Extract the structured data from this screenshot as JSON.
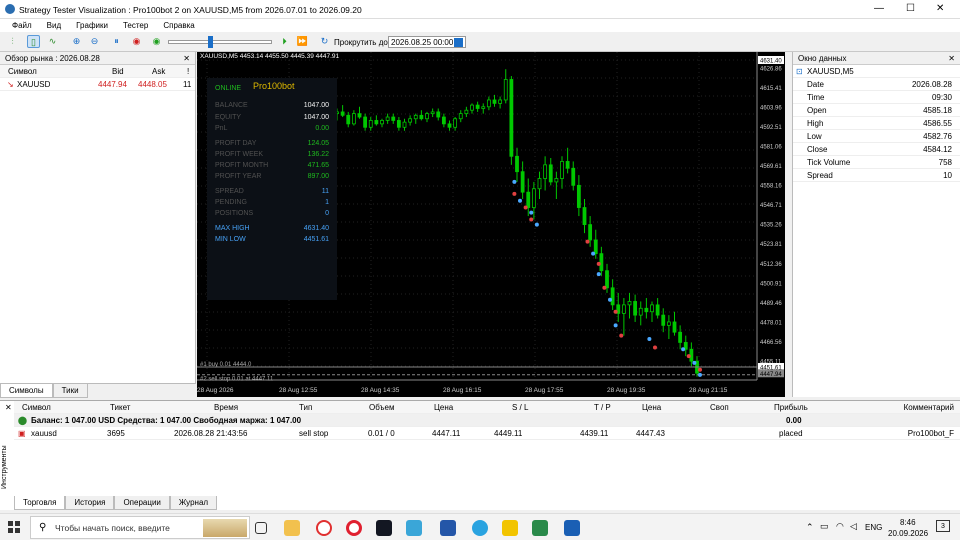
{
  "window": {
    "title": "Strategy Tester Visualization : Pro100bot 2 on XAUUSD,M5 from 2026.07.01 to 2026.09.20",
    "min": "—",
    "max": "☐",
    "close": "✕"
  },
  "menu": [
    "Файл",
    "Вид",
    "Графики",
    "Тестер",
    "Справка"
  ],
  "toolbar": {
    "scroll_label": "Прокрутить до",
    "date_value": "2026.08.25 00:00"
  },
  "market_watch": {
    "title": "Обзор рынка : 2026.08.28",
    "col_symbol": "Символ",
    "col_bid": "Bid",
    "col_ask": "Ask",
    "col_n": "!",
    "symbol": "XAUUSD",
    "bid": "4447.94",
    "ask": "4448.05",
    "n": "11",
    "tabs": [
      "Символы",
      "Тики"
    ]
  },
  "data_window": {
    "title": "Окно данных",
    "symbol": "XAUUSD,M5",
    "rows": [
      [
        "Date",
        "2026.08.28"
      ],
      [
        "Time",
        "09:30"
      ],
      [
        "Open",
        "4585.18"
      ],
      [
        "High",
        "4586.55"
      ],
      [
        "Low",
        "4582.76"
      ],
      [
        "Close",
        "4584.12"
      ],
      [
        "Tick Volume",
        "758"
      ],
      [
        "Spread",
        "10"
      ]
    ]
  },
  "chart": {
    "header": "XAUUSD,M5  4453.14 4455.50 4445.39 4447.91",
    "price_labels": [
      "4631.40",
      "4626.86",
      "4615.41",
      "4603.96",
      "4592.51",
      "4581.06",
      "4569.61",
      "4558.16",
      "4546.71",
      "4535.26",
      "4523.81",
      "4512.36",
      "4500.91",
      "4489.46",
      "4478.01",
      "4466.56",
      "4455.11",
      "4451.61",
      "4447.94"
    ],
    "time_labels": [
      "28 Aug 2026",
      "28 Aug 12:55",
      "28 Aug 14:35",
      "28 Aug 16:15",
      "28 Aug 17:55",
      "28 Aug 19:35",
      "28 Aug 21:15"
    ],
    "sl_line": "#1 buy 0.01 4444.0",
    "stop_line": "#2 sell stop 0.01 at 4447.11",
    "close_label": "4447.94"
  },
  "panel": {
    "online": "ONLINE",
    "name": "Pro100bot",
    "rows": [
      [
        "BALANCE",
        "1047.00"
      ],
      [
        "EQUITY",
        "1047.00"
      ],
      [
        "PnL",
        "0.00"
      ],
      [
        "PROFIT DAY",
        "124.05"
      ],
      [
        "PROFIT WEEK",
        "136.22"
      ],
      [
        "PROFIT MONTH",
        "471.65"
      ],
      [
        "PROFIT YEAR",
        "897.00"
      ],
      [
        "SPREAD",
        "11"
      ],
      [
        "PENDING",
        "1"
      ],
      [
        "POSITIONS",
        "0"
      ],
      [
        "MAX HIGH",
        "4631.40"
      ],
      [
        "MIN LOW",
        "4451.61"
      ]
    ]
  },
  "colors": {
    "candle": "#00c800",
    "panel_bg": "#0d1117",
    "green": "#20c020",
    "blue": "#4aa8ff",
    "gold": "#e8c000"
  },
  "terminal": {
    "headers": [
      "Символ",
      "Тикет",
      "Время",
      "Тип",
      "Объем",
      "Цена",
      "S / L",
      "T / P",
      "Цена",
      "Своп",
      "Прибыль",
      "Комментарий"
    ],
    "summary": "Баланс: 1 047.00 USD  Средства: 1 047.00  Свободная маржа: 1 047.00",
    "summary_profit": "0.00",
    "order": [
      "xauusd",
      "3695",
      "2026.08.28 21:43:56",
      "sell stop",
      "0.01 / 0",
      "4447.11",
      "4449.11",
      "4439.11",
      "4447.43",
      "",
      "placed",
      "Pro100bot_F"
    ],
    "tabs": [
      "Торговля",
      "История",
      "Операции",
      "Журнал"
    ],
    "side": "Инструменты"
  },
  "taskbar": {
    "search": "Чтобы начать поиск, введите",
    "lang": "ENG",
    "time": "8:46",
    "date": "20.09.2026",
    "notif": "3"
  },
  "candles": [
    [
      4600,
      4603,
      4596,
      4601
    ],
    [
      4601,
      4605,
      4598,
      4599
    ],
    [
      4599,
      4601,
      4592,
      4594
    ],
    [
      4594,
      4602,
      4593,
      4600
    ],
    [
      4600,
      4604,
      4597,
      4598
    ],
    [
      4598,
      4600,
      4590,
      4592
    ],
    [
      4592,
      4598,
      4590,
      4596
    ],
    [
      4596,
      4599,
      4593,
      4594
    ],
    [
      4594,
      4597,
      4592,
      4596
    ],
    [
      4596,
      4600,
      4594,
      4598
    ],
    [
      4598,
      4600,
      4594,
      4596
    ],
    [
      4596,
      4598,
      4590,
      4592
    ],
    [
      4592,
      4597,
      4590,
      4595
    ],
    [
      4595,
      4599,
      4593,
      4597
    ],
    [
      4597,
      4600,
      4594,
      4599
    ],
    [
      4599,
      4602,
      4596,
      4597
    ],
    [
      4597,
      4601,
      4595,
      4600
    ],
    [
      4600,
      4603,
      4598,
      4601
    ],
    [
      4601,
      4603,
      4596,
      4598
    ],
    [
      4598,
      4600,
      4592,
      4594
    ],
    [
      4594,
      4596,
      4590,
      4592
    ],
    [
      4592,
      4598,
      4590,
      4597
    ],
    [
      4597,
      4602,
      4595,
      4600
    ],
    [
      4600,
      4604,
      4598,
      4602
    ],
    [
      4602,
      4606,
      4600,
      4605
    ],
    [
      4605,
      4607,
      4601,
      4603
    ],
    [
      4603,
      4606,
      4600,
      4604
    ],
    [
      4604,
      4610,
      4602,
      4608
    ],
    [
      4608,
      4611,
      4604,
      4606
    ],
    [
      4606,
      4610,
      4603,
      4608
    ],
    [
      4608,
      4626,
      4606,
      4620
    ],
    [
      4620,
      4622,
      4570,
      4575
    ],
    [
      4575,
      4580,
      4560,
      4566
    ],
    [
      4566,
      4572,
      4550,
      4554
    ],
    [
      4554,
      4562,
      4540,
      4545
    ],
    [
      4545,
      4560,
      4538,
      4556
    ],
    [
      4556,
      4566,
      4550,
      4562
    ],
    [
      4562,
      4575,
      4555,
      4570
    ],
    [
      4570,
      4574,
      4558,
      4560
    ],
    [
      4560,
      4566,
      4550,
      4562
    ],
    [
      4562,
      4575,
      4556,
      4572
    ],
    [
      4572,
      4580,
      4565,
      4568
    ],
    [
      4568,
      4572,
      4555,
      4558
    ],
    [
      4558,
      4564,
      4540,
      4545
    ],
    [
      4545,
      4550,
      4530,
      4535
    ],
    [
      4535,
      4540,
      4522,
      4526
    ],
    [
      4526,
      4532,
      4515,
      4518
    ],
    [
      4518,
      4522,
      4505,
      4508
    ],
    [
      4508,
      4512,
      4495,
      4498
    ],
    [
      4498,
      4503,
      4485,
      4488
    ],
    [
      4488,
      4495,
      4478,
      4483
    ],
    [
      4483,
      4492,
      4470,
      4488
    ],
    [
      4488,
      4495,
      4480,
      4490
    ],
    [
      4490,
      4494,
      4478,
      4482
    ],
    [
      4482,
      4490,
      4476,
      4486
    ],
    [
      4486,
      4492,
      4480,
      4484
    ],
    [
      4484,
      4490,
      4478,
      4488
    ],
    [
      4488,
      4492,
      4480,
      4482
    ],
    [
      4482,
      4486,
      4472,
      4476
    ],
    [
      4476,
      4482,
      4468,
      4478
    ],
    [
      4478,
      4484,
      4470,
      4472
    ],
    [
      4472,
      4476,
      4462,
      4466
    ],
    [
      4466,
      4470,
      4458,
      4462
    ],
    [
      4462,
      4466,
      4452,
      4455
    ],
    [
      4455,
      4458,
      4446,
      4448
    ]
  ]
}
